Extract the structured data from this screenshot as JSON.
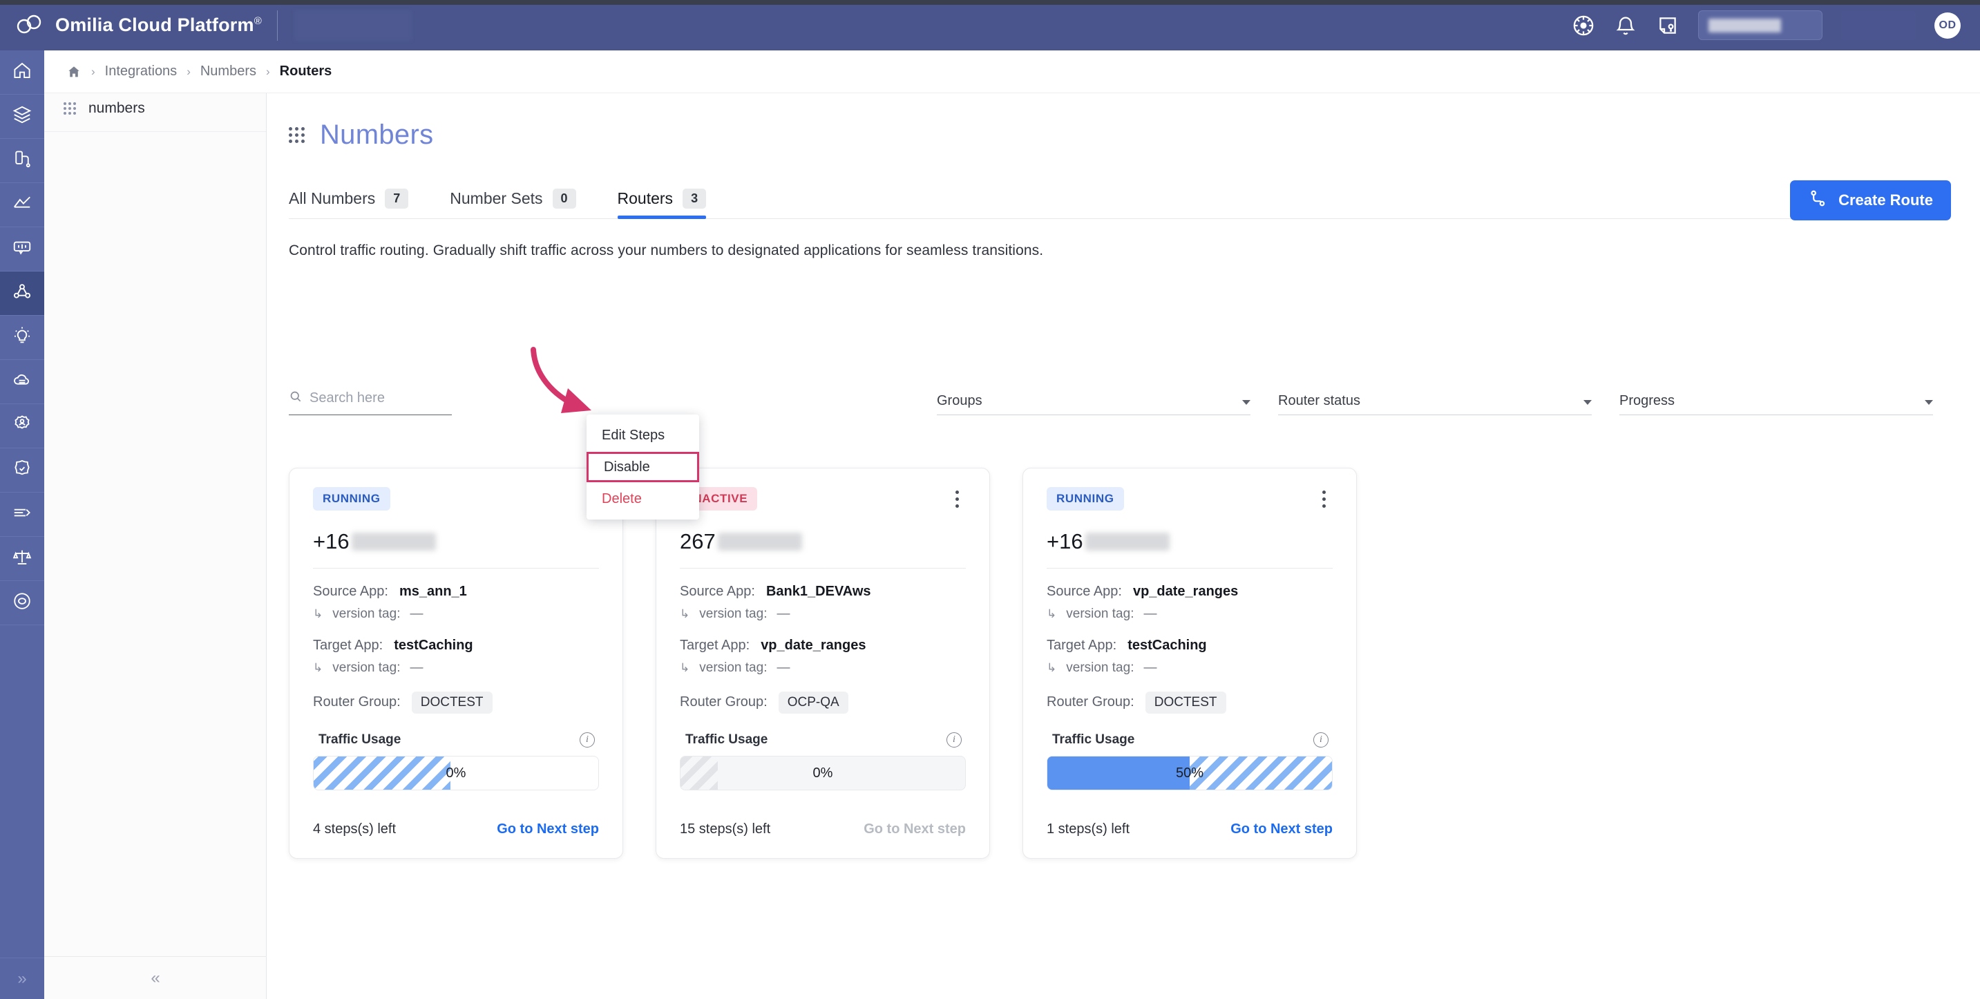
{
  "header": {
    "brand": "Omilia Cloud Platform",
    "brand_sup": "®",
    "icons": [
      "help-wheel-icon",
      "bell-icon",
      "notes-key-icon"
    ],
    "avatar_initials": "OD"
  },
  "rail": {
    "items": [
      {
        "name": "home",
        "active": false
      },
      {
        "name": "layers",
        "active": false
      },
      {
        "name": "devices",
        "active": false
      },
      {
        "name": "analytics",
        "active": false
      },
      {
        "name": "dialog",
        "active": false
      },
      {
        "name": "integrations",
        "active": true
      },
      {
        "name": "insights",
        "active": false
      },
      {
        "name": "cloud",
        "active": false
      },
      {
        "name": "admin-users",
        "active": false
      },
      {
        "name": "security",
        "active": false
      },
      {
        "name": "tools",
        "active": false
      },
      {
        "name": "compliance",
        "active": false
      },
      {
        "name": "support",
        "active": false
      }
    ],
    "collapse_glyph": "»"
  },
  "subnav": {
    "item_label": "numbers",
    "collapse_glyph": "«"
  },
  "breadcrumb": {
    "home_icon": "home-icon",
    "separator": "›",
    "items": [
      "Integrations",
      "Numbers"
    ],
    "current": "Routers"
  },
  "page": {
    "title": "Numbers",
    "description": "Control traffic routing. Gradually shift traffic across your numbers to designated applications for seamless transitions.",
    "create_button": "Create Route"
  },
  "tabs": [
    {
      "label": "All Numbers",
      "count": "7",
      "active": false
    },
    {
      "label": "Number Sets",
      "count": "0",
      "active": false
    },
    {
      "label": "Routers",
      "count": "3",
      "active": true
    }
  ],
  "filters": {
    "search_placeholder": "Search here",
    "selects": [
      {
        "label": "Groups"
      },
      {
        "label": "Router status"
      },
      {
        "label": "Progress"
      }
    ]
  },
  "labels": {
    "source_app": "Source App:",
    "target_app": "Target App:",
    "version_tag": "version tag:",
    "router_group": "Router Group:",
    "traffic_usage": "Traffic Usage",
    "version_tag_value": "—",
    "sub_arrow": "↳",
    "next_step": "Go to Next step"
  },
  "cards": [
    {
      "status": "RUNNING",
      "status_kind": "running",
      "number_prefix": "+16",
      "redact_width": 122,
      "source_app": "ms_ann_1",
      "source_version_tag": "—",
      "target_app": "testCaching",
      "target_version_tag": "—",
      "router_group": "DOCTEST",
      "progress_pct": 0,
      "progress_label": "0%",
      "bar_style": "hatch-blue",
      "steps_left": "4 steps(s) left",
      "next_step": "Go to Next step",
      "next_step_enabled": true
    },
    {
      "status": "INACTIVE",
      "status_kind": "inactive",
      "number_prefix": "267",
      "redact_width": 122,
      "source_app": "Bank1_DEVAws",
      "source_version_tag": "—",
      "target_app": "vp_date_ranges",
      "target_version_tag": "—",
      "router_group": "OCP-QA",
      "progress_pct": 0,
      "progress_label": "0%",
      "bar_style": "hatch-grey",
      "steps_left": "15 steps(s) left",
      "next_step": "Go to Next step",
      "next_step_enabled": false
    },
    {
      "status": "RUNNING",
      "status_kind": "running",
      "number_prefix": "+16",
      "redact_width": 122,
      "source_app": "vp_date_ranges",
      "source_version_tag": "—",
      "target_app": "testCaching",
      "target_version_tag": "—",
      "router_group": "DOCTEST",
      "progress_pct": 50,
      "progress_label": "50%",
      "bar_style": "solid-hatch",
      "steps_left": "1 steps(s) left",
      "next_step": "Go to Next step",
      "next_step_enabled": true
    }
  ],
  "context_menu": {
    "items": [
      {
        "label": "Edit Steps",
        "kind": "normal",
        "highlighted": false
      },
      {
        "label": "Disable",
        "kind": "normal",
        "highlighted": true
      },
      {
        "label": "Delete",
        "kind": "danger",
        "highlighted": false
      }
    ]
  },
  "colors": {
    "header_bg": "#49558c",
    "rail_bg": "#5866a4",
    "rail_active": "#3f4d85",
    "accent_blue": "#2e6ff2",
    "title_blue": "#7185d6",
    "running_badge_bg": "#e4edfd",
    "running_badge_fg": "#2a5bc0",
    "inactive_badge_bg": "#fbe1e7",
    "inactive_badge_fg": "#cf3a56",
    "annotation_pink": "#d4366c",
    "delete_red": "#e04258",
    "bar_blue": "#5b93f0"
  }
}
